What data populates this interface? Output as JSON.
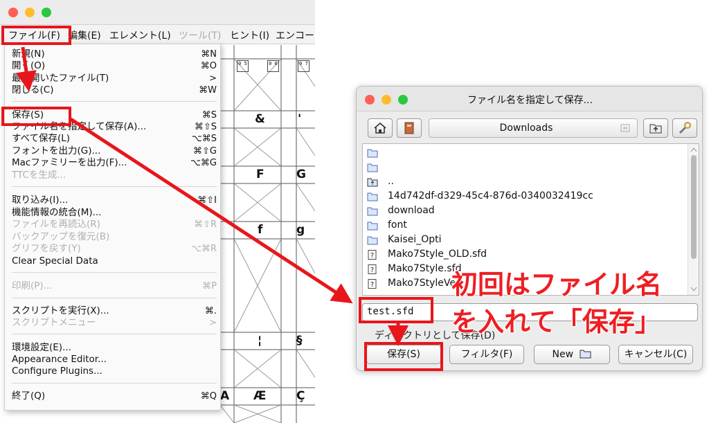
{
  "left_menubar": {
    "items": [
      {
        "label": "ファイル(F)"
      },
      {
        "label": "編集(E)"
      },
      {
        "label": "エレメント(L)"
      },
      {
        "label": "ツール(T)"
      },
      {
        "label": "ヒント(I)"
      },
      {
        "label": "エンコー"
      }
    ]
  },
  "file_menu": {
    "items": [
      {
        "label": "新規(N)",
        "shortcut": "⌘N"
      },
      {
        "label": "開く(O)",
        "shortcut": "⌘O"
      },
      {
        "label": "最近開いたファイル(T)",
        "shortcut": ">"
      },
      {
        "label": "閉じる(C)",
        "shortcut": "⌘W"
      },
      {
        "label": "保存(S)",
        "shortcut": "⌘S"
      },
      {
        "label": "ファイル名を指定して保存(A)...",
        "shortcut": "⌘⇧S"
      },
      {
        "label": "すべて保存(L)",
        "shortcut": "⌥⌘S"
      },
      {
        "label": "フォントを出力(G)...",
        "shortcut": "⌘⇧G"
      },
      {
        "label": "Macファミリーを出力(F)...",
        "shortcut": "⌥⌘G"
      },
      {
        "label": "TTCを生成...",
        "shortcut": ""
      },
      {
        "label": "取り込み(I)...",
        "shortcut": "⌘⇧I"
      },
      {
        "label": "機能情報の統合(M)...",
        "shortcut": ""
      },
      {
        "label": "ファイルを再読込(R)",
        "shortcut": "⌘⇧R"
      },
      {
        "label": "バックアップを復元(B)",
        "shortcut": ""
      },
      {
        "label": "グリフを戻す(Y)",
        "shortcut": "⌥⌘R"
      },
      {
        "label": "Clear Special Data",
        "shortcut": ""
      },
      {
        "label": "印刷(P)...",
        "shortcut": "⌘P"
      },
      {
        "label": "スクリプトを実行(X)...",
        "shortcut": "⌘."
      },
      {
        "label": "スクリプトメニュー",
        "shortcut": ">"
      },
      {
        "label": "環境設定(E)...",
        "shortcut": ""
      },
      {
        "label": "Appearance Editor...",
        "shortcut": ""
      },
      {
        "label": "Configure Plugins...",
        "shortcut": ""
      },
      {
        "label": "終了(Q)",
        "shortcut": "⌘Q"
      }
    ]
  },
  "glyph_grid": {
    "hex_labels": [
      "0 5",
      "0 6",
      "0 7"
    ],
    "glyphs": [
      "&",
      "'",
      "F",
      "G",
      "f",
      "g",
      "¦",
      "§",
      "A",
      "Æ",
      "Ç"
    ]
  },
  "save_dialog": {
    "title": "ファイル名を指定して保存...",
    "directory": "Downloads",
    "files": [
      {
        "name": "",
        "type": "folder"
      },
      {
        "name": "",
        "type": "folder"
      },
      {
        "name": "..",
        "type": "parent"
      },
      {
        "name": "14d742df-d329-45c4-876d-0340032419cc",
        "type": "folder"
      },
      {
        "name": "download",
        "type": "folder"
      },
      {
        "name": "font",
        "type": "folder"
      },
      {
        "name": "Kaisei_Opti",
        "type": "folder"
      },
      {
        "name": "Mako7Style_OLD.sfd",
        "type": "file"
      },
      {
        "name": "Mako7Style.sfd",
        "type": "file"
      },
      {
        "name": "Mako7StyleVe",
        "type": "file"
      }
    ],
    "filename_value": "test.sfd",
    "dir_save_label": "ディレクトリとして保存(D)",
    "buttons": {
      "save": "保存(S)",
      "filter": "フィルタ(F)",
      "new": "New",
      "cancel": "キャンセル(C)"
    }
  },
  "annotation": {
    "line1": "初回はファイル名",
    "line2": "を入れて「保存」"
  },
  "colors": {
    "highlight_red": "#e8161b",
    "annotation_red": "#ee1e23",
    "traffic_close": "#fe5f57",
    "traffic_min": "#febc2e",
    "traffic_max": "#28c840",
    "folder_blue": "#7fa8e6"
  }
}
